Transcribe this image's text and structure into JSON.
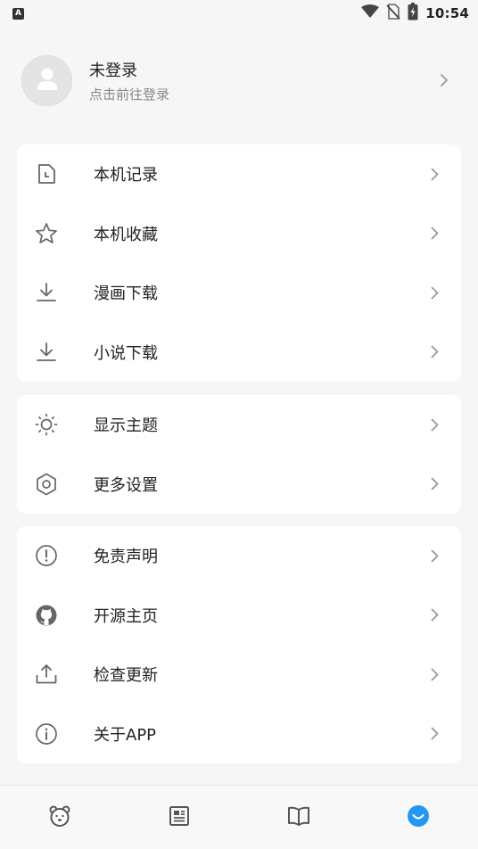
{
  "status_bar": {
    "app_indicator": "A",
    "time": "10:54",
    "icons": [
      "wifi-icon",
      "no-sim-icon",
      "battery-charging-icon"
    ]
  },
  "profile": {
    "name": "未登录",
    "subtitle": "点击前往登录",
    "icons": [
      "avatar-icon",
      "chevron-right-icon"
    ]
  },
  "groups": [
    {
      "items": [
        {
          "label": "本机记录",
          "icon": "history-file-icon"
        },
        {
          "label": "本机收藏",
          "icon": "star-icon"
        },
        {
          "label": "漫画下载",
          "icon": "download-icon"
        },
        {
          "label": "小说下载",
          "icon": "download-icon"
        }
      ]
    },
    {
      "items": [
        {
          "label": "显示主题",
          "icon": "sun-icon"
        },
        {
          "label": "更多设置",
          "icon": "settings-hexagon-icon"
        }
      ]
    },
    {
      "items": [
        {
          "label": "免责声明",
          "icon": "alert-circle-icon"
        },
        {
          "label": "开源主页",
          "icon": "github-icon"
        },
        {
          "label": "检查更新",
          "icon": "upload-icon"
        },
        {
          "label": "关于APP",
          "icon": "info-icon"
        }
      ]
    }
  ],
  "bottom_nav": {
    "items": [
      {
        "icon": "bear-icon",
        "active": false
      },
      {
        "icon": "newspaper-icon",
        "active": false
      },
      {
        "icon": "book-open-icon",
        "active": false
      },
      {
        "icon": "smile-icon",
        "active": true
      }
    ],
    "active_color": "#2196f3",
    "inactive_color": "#555555"
  },
  "colors": {
    "background": "#f6f6f6",
    "card": "#ffffff",
    "text_primary": "#222222",
    "text_secondary": "#888888",
    "icon": "#666666",
    "chevron": "#999999"
  }
}
